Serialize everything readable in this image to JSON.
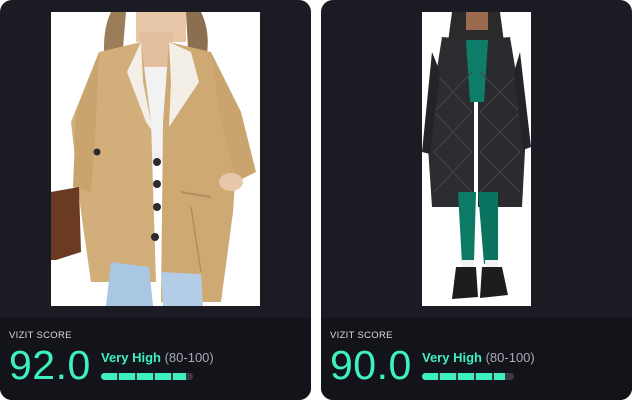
{
  "cards": [
    {
      "label": "VIZIT SCORE",
      "score": "92.0",
      "rating": "Very High",
      "range": "(80-100)",
      "level_percent": 92,
      "image_icon": "tan-sherpa-coat-photo"
    },
    {
      "label": "VIZIT SCORE",
      "score": "90.0",
      "rating": "Very High",
      "range": "(80-100)",
      "level_percent": 90,
      "image_icon": "black-puffer-coat-photo"
    }
  ],
  "colors": {
    "card_bg": "#1b1b23",
    "panel_bg": "#13131a",
    "accent": "#3ff0bf",
    "muted_text": "#a9a9b3",
    "track": "#3a3a44"
  }
}
